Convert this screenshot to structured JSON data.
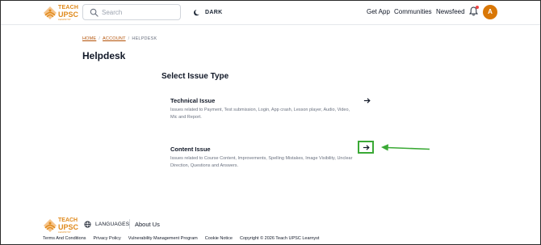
{
  "brand": {
    "line1": "TEACH",
    "line2": "UPSC",
    "line3": "LEARNYST",
    "color": "#e08a1c"
  },
  "header": {
    "search": {
      "placeholder": "Search"
    },
    "theme_toggle": {
      "label": "DARK",
      "icon": "moon-icon"
    },
    "nav": {
      "get_app": "Get App",
      "communities": "Communities",
      "newsfeed": "Newsfeed"
    },
    "notifications_icon": "bell-icon",
    "avatar_initial": "A",
    "avatar_color": "#d97706"
  },
  "breadcrumb": {
    "items": [
      "HOME",
      "ACCOUNT",
      "HELPDESK"
    ],
    "separator": "/"
  },
  "page": {
    "title": "Helpdesk",
    "section_title": "Select Issue Type"
  },
  "issues": [
    {
      "title": "Technical Issue",
      "description": "Issues related to Payment, Test submission, Login, App crash, Lesson player, Audio, Video, Mic and Report.",
      "action_icon": "arrow-right-icon"
    },
    {
      "title": "Content Issue",
      "description": "Issues related to Course Content, Improvements, Spelling Mistakes, Image Visibility, Unclear Direction, Questions and Answers.",
      "action_icon": "arrow-right-icon",
      "highlight_color": "#3aa935"
    }
  ],
  "footer": {
    "languages_label": "LANGUAGES",
    "about_label": "About Us",
    "links": [
      "Terms And Conditions",
      "Privacy Policy",
      "Vulnerability Management Program",
      "Cookie Notice",
      "Copyright © 2026 Teach UPSC Learnyst"
    ]
  }
}
